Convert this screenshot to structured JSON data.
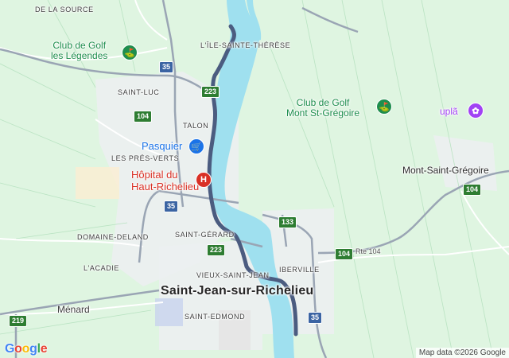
{
  "map": {
    "localities": {
      "de_la_source": "DE LA SOURCE",
      "ile_sainte_therese": "L'ÎLE-SAINTE-THÉRÈSE",
      "saint_luc": "SAINT-LUC",
      "talon": "TALON",
      "les_pres_verts": "LES PRÉS-VERTS",
      "domaine_deland": "DOMAINE-DELAND",
      "saint_gerard": "SAINT-GÉRARD",
      "lacadie": "L'ACADIE",
      "vieux_saint_jean": "VIEUX-SAINT-JEAN",
      "iberville": "IBERVILLE",
      "saint_edmond": "SAINT-EDMOND"
    },
    "places": {
      "menard": "Ménard",
      "mont_saint_gregoire": "Mont-Saint-Grégoire",
      "saint_jean": "Saint-Jean-sur-Richelieu"
    },
    "pois": {
      "golf_legendes": "Club de Golf\nles Légendes",
      "golf_mont": "Club de Golf\nMont St-Grégoire",
      "pasquier": "Pasquier",
      "hopital": "Hôpital du\nHaut-Richelieu",
      "upla": "uplã"
    },
    "shields": {
      "r35_a": "35",
      "r35_b": "35",
      "r35_c": "35",
      "r104_a": "104",
      "r104_b": "104",
      "r104_c": "104",
      "r223_a": "223",
      "r223_b": "223",
      "r133": "133",
      "r219": "219"
    },
    "road_label": "Rte 104",
    "google": "Google",
    "attribution": "Map data ©2026 Google"
  },
  "colors": {
    "land": "#dff5e1",
    "water": "#9fe0ef",
    "route": "#4b5c80",
    "road": "#ffffff",
    "urban": "#eef0f2"
  },
  "icons": [
    "golf-icon",
    "shopping-cart-icon",
    "hospital-icon",
    "attraction-icon"
  ]
}
